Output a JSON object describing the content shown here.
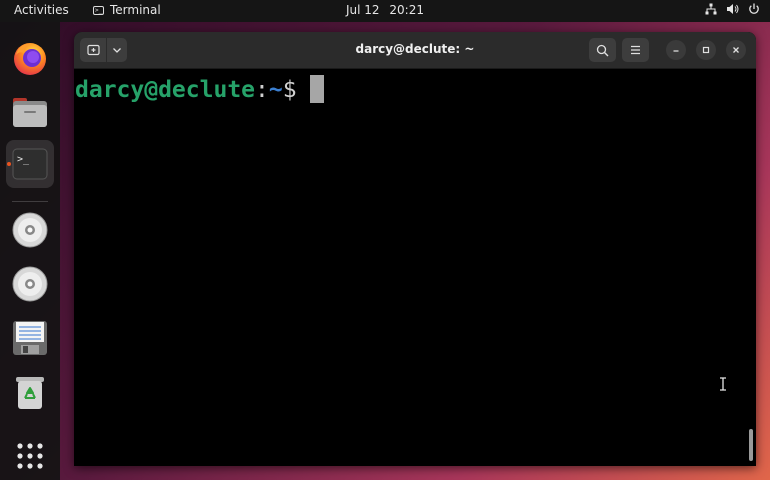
{
  "topbar": {
    "activities_label": "Activities",
    "app_name": "Terminal",
    "date": "Jul 12",
    "time": "20:21"
  },
  "dock": {
    "items": [
      {
        "name": "firefox",
        "icon": "firefox-icon"
      },
      {
        "name": "files",
        "icon": "folder-icon"
      },
      {
        "name": "terminal",
        "icon": "terminal-icon",
        "running": true
      },
      {
        "name": "disc-1",
        "icon": "optical-disc-icon"
      },
      {
        "name": "disc-2",
        "icon": "optical-disc-icon"
      },
      {
        "name": "floppy",
        "icon": "floppy-disk-icon"
      },
      {
        "name": "trash",
        "icon": "trash-icon"
      },
      {
        "name": "show-apps",
        "icon": "app-grid-icon"
      }
    ]
  },
  "window": {
    "title": "darcy@declute: ~"
  },
  "terminal": {
    "user_host": "darcy@declute",
    "separator": ":",
    "path": "~",
    "symbol": "$"
  },
  "colors": {
    "prompt_user": "#26a269",
    "prompt_path": "#3b7fd1",
    "accent": "#e95420",
    "terminal_bg": "#000000"
  }
}
